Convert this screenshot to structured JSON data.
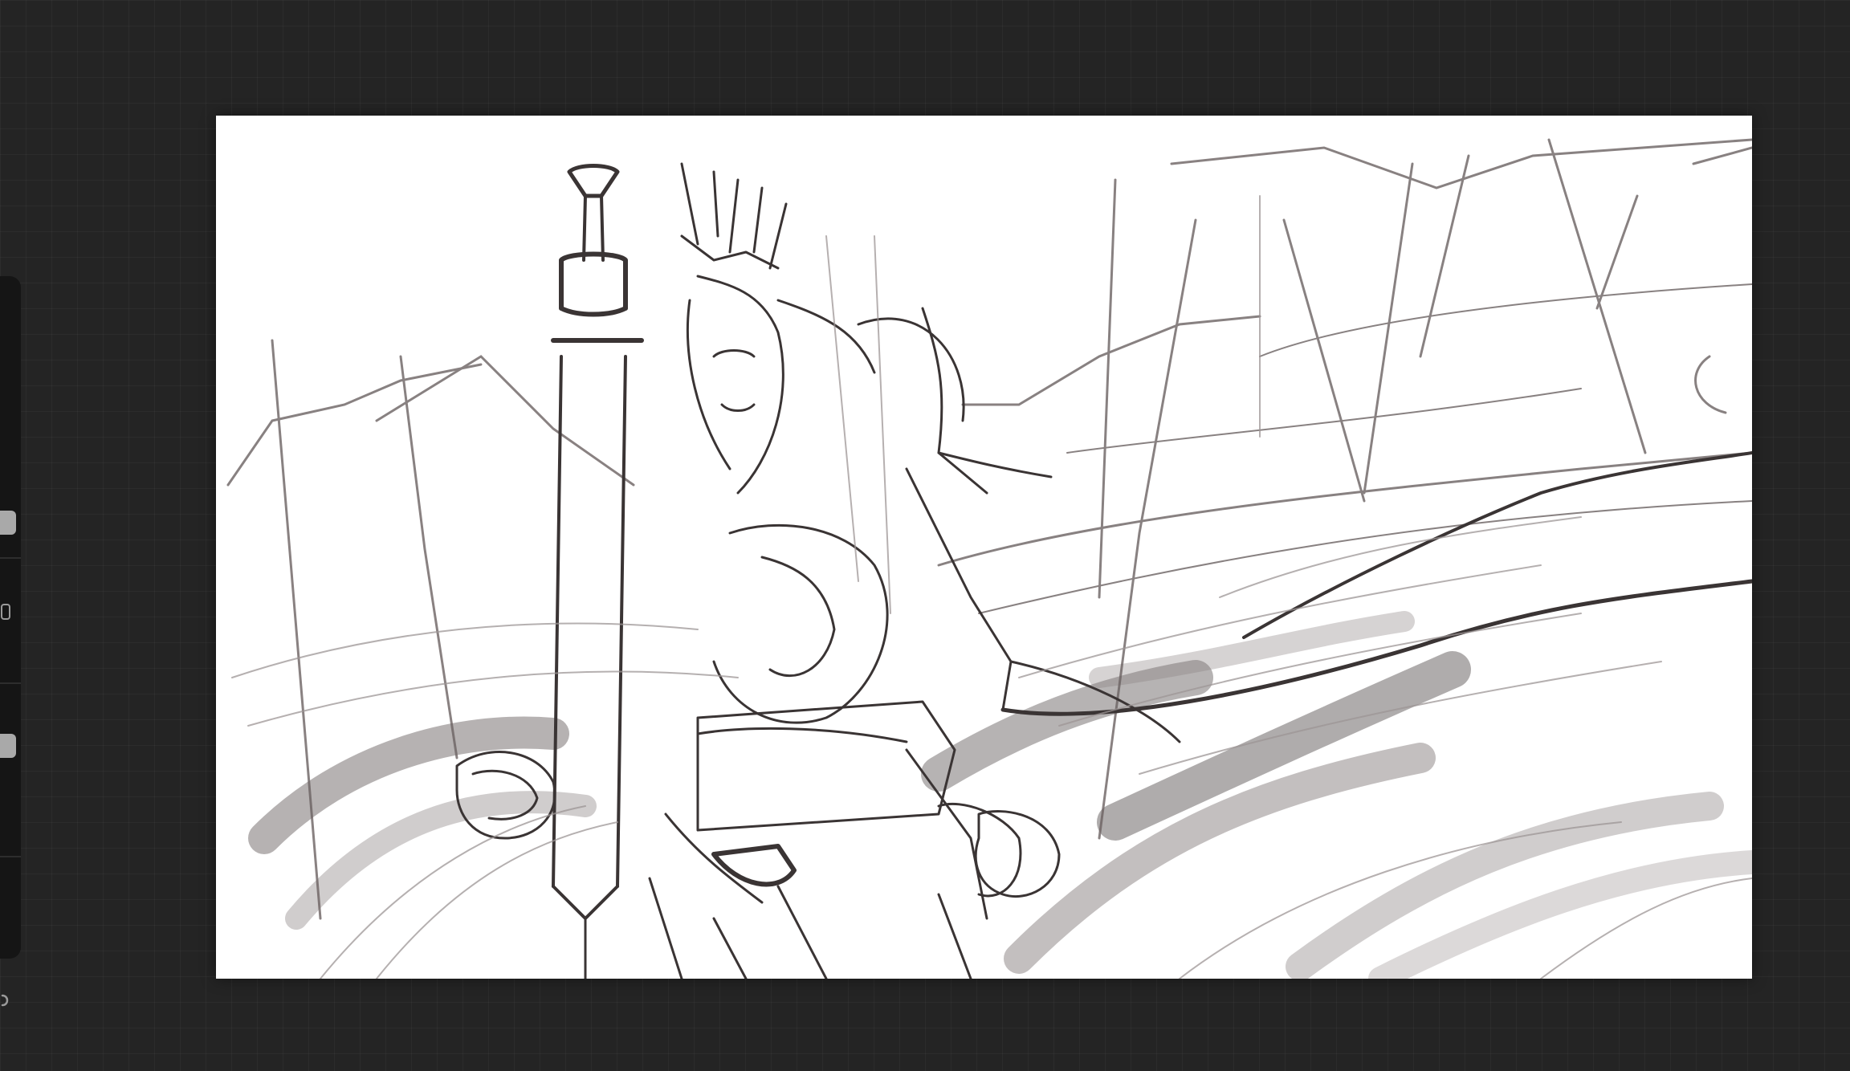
{
  "app": {
    "workspace_bg": "#242424",
    "canvas_bg": "#ffffff",
    "sidebar_bg": "#151515",
    "ink_color": "#3a3434",
    "shade_color": "#6e6767"
  },
  "sidebar": {
    "brush_size_slider": {
      "icon": "slider-handle"
    },
    "modify_button": {
      "icon": "square-outline-icon"
    },
    "brush_opacity_slider": {
      "icon": "slider-handle"
    },
    "undo_button": {
      "icon": "undo-icon"
    }
  },
  "canvas": {
    "subject": "sketch"
  }
}
